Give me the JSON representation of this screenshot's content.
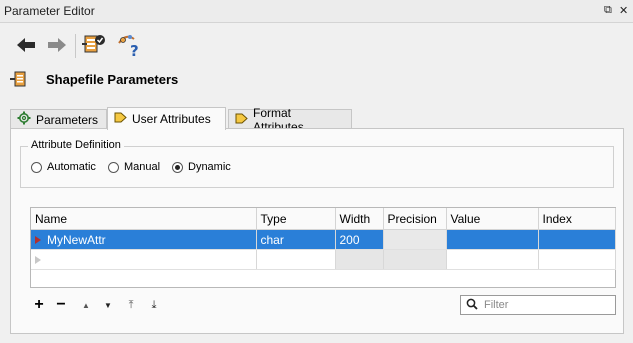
{
  "window": {
    "title": "Parameter Editor",
    "float_icon": "float-icon",
    "close_icon": "close-icon",
    "float_glyph": "⧉",
    "close_glyph": "✕"
  },
  "toolbar": {
    "back_icon": "back-arrow-icon",
    "forward_icon": "forward-arrow-icon",
    "apply_icon": "apply-parameters-icon",
    "help_icon": "help-icon"
  },
  "header": {
    "title": "Shapefile Parameters",
    "icon": "shapefile-icon"
  },
  "tabs": [
    {
      "label": "Parameters",
      "icon": "gear-icon",
      "active": false
    },
    {
      "label": "User Attributes",
      "icon": "tag-icon",
      "active": true
    },
    {
      "label": "Format Attributes",
      "icon": "tag-icon",
      "active": false
    }
  ],
  "attribute_definition": {
    "title": "Attribute Definition",
    "options": [
      "Automatic",
      "Manual",
      "Dynamic"
    ],
    "selected": "Dynamic"
  },
  "table": {
    "columns": [
      "Name",
      "Type",
      "Width",
      "Precision",
      "Value",
      "Index"
    ],
    "rows": [
      {
        "name": "MyNewAttr",
        "type": "char",
        "width": "200",
        "precision": "",
        "value": "",
        "index": ""
      }
    ]
  },
  "bottom_toolbar": {
    "add": "+",
    "remove": "−",
    "move_up": "▲",
    "move_down": "▼",
    "move_top": "⤒",
    "move_bottom": "⤓"
  },
  "filter": {
    "placeholder": "Filter",
    "value": "",
    "icon": "search-icon"
  },
  "colors": {
    "selection": "#2a7fd8",
    "row_marker": "#b03030"
  }
}
